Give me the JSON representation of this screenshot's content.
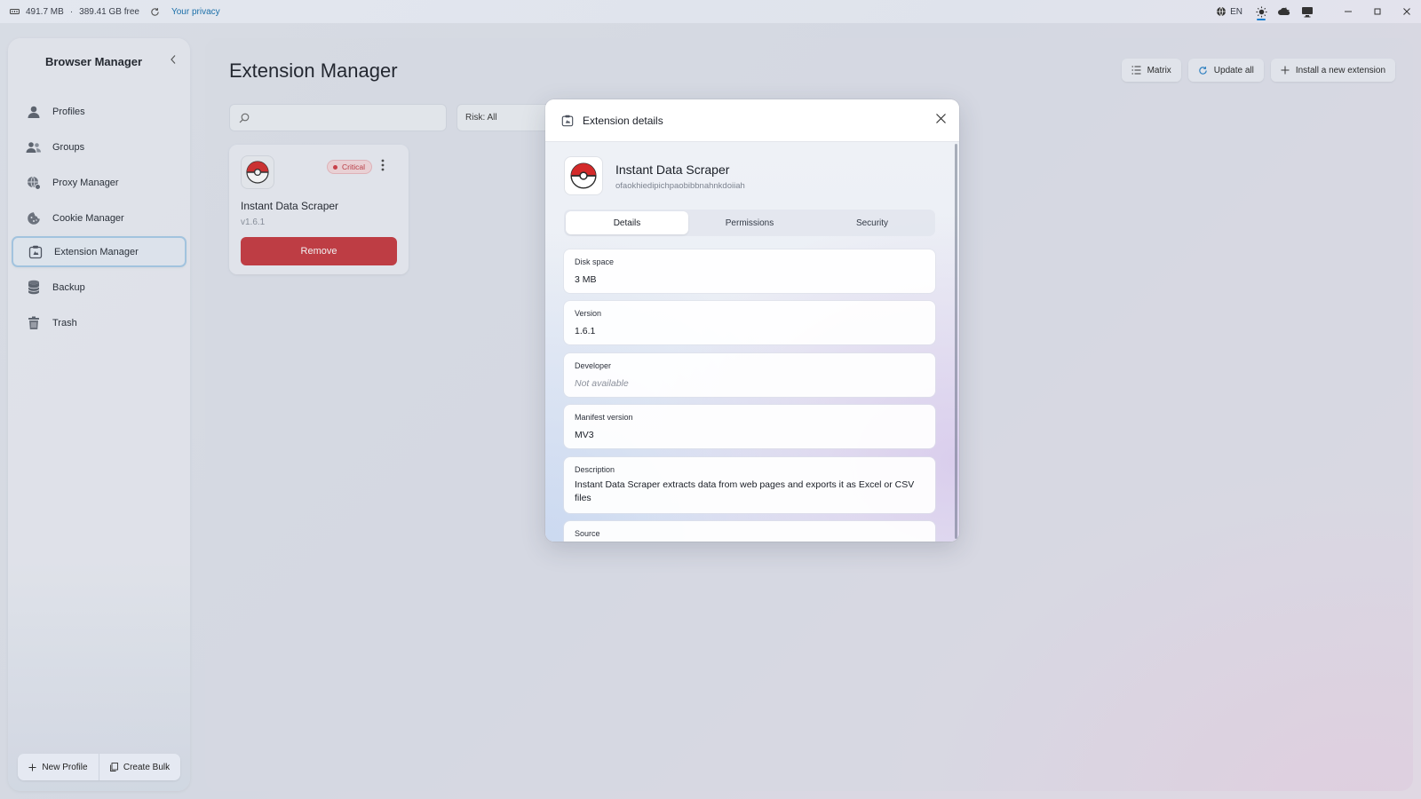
{
  "topbar": {
    "memory": "491.7 MB",
    "separator": "·",
    "disk_free": "389.41 GB free",
    "privacy_link": "Your privacy",
    "language": "EN"
  },
  "sidebar": {
    "title": "Browser Manager",
    "items": [
      {
        "label": "Profiles",
        "icon": "user-icon"
      },
      {
        "label": "Groups",
        "icon": "groups-icon"
      },
      {
        "label": "Proxy Manager",
        "icon": "globe-network-icon"
      },
      {
        "label": "Cookie Manager",
        "icon": "cookie-icon"
      },
      {
        "label": "Extension Manager",
        "icon": "extension-icon",
        "active": true
      },
      {
        "label": "Backup",
        "icon": "database-icon"
      },
      {
        "label": "Trash",
        "icon": "trash-icon"
      }
    ],
    "new_profile": "New Profile",
    "create_bulk": "Create Bulk"
  },
  "main": {
    "title": "Extension Manager",
    "actions": {
      "matrix": "Matrix",
      "update_all": "Update all",
      "install": "Install a new extension"
    },
    "search": {
      "placeholder": ""
    },
    "risk_filter": "Risk: All",
    "card": {
      "name": "Instant Data Scraper",
      "version": "v1.6.1",
      "risk_badge": "Critical",
      "remove_label": "Remove"
    }
  },
  "modal": {
    "title": "Extension details",
    "ext_name": "Instant Data Scraper",
    "ext_id": "ofaokhiedipichpaobibbnahnkdoiiah",
    "tabs": [
      "Details",
      "Permissions",
      "Security"
    ],
    "active_tab": "Details",
    "fields": {
      "disk_space": {
        "label": "Disk space",
        "value": "3 MB"
      },
      "version": {
        "label": "Version",
        "value": "1.6.1"
      },
      "developer": {
        "label": "Developer",
        "value": "Not available"
      },
      "manifest": {
        "label": "Manifest version",
        "value": "MV3"
      },
      "description": {
        "label": "Description",
        "value": "Instant Data Scraper extracts data from web pages and exports it as Excel or CSV files"
      },
      "source": {
        "label": "Source"
      }
    }
  },
  "colors": {
    "accent": "#1a7fd0",
    "danger": "#c7363d",
    "active_border": "#a8cbe8"
  }
}
